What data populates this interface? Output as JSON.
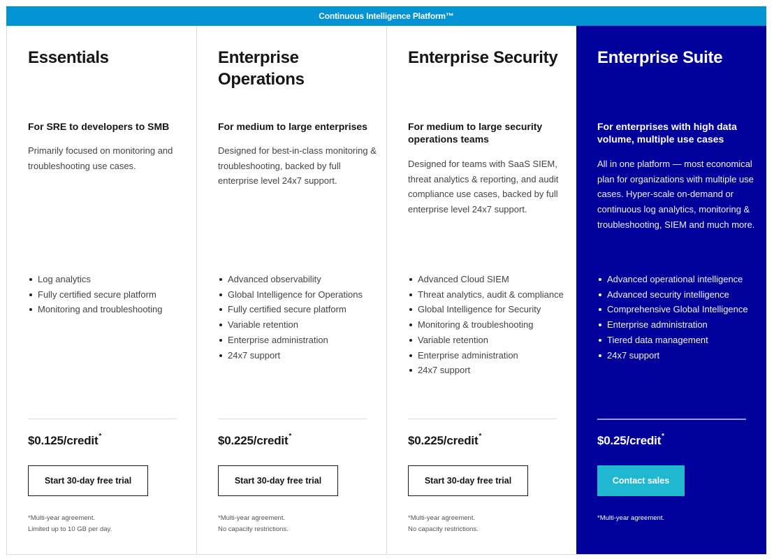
{
  "banner": {
    "title": "Continuous Intelligence Platform™"
  },
  "colors": {
    "banner": "#0193d3",
    "featured_bg": "#00009b",
    "cta_accent": "#20b8d0"
  },
  "plans": [
    {
      "title": "Essentials",
      "subtitle": "For SRE to developers to SMB",
      "description": "Primarily focused on monitoring and troubleshooting use cases.",
      "features": [
        "Log analytics",
        "Fully certified secure platform",
        "Monitoring and troubleshooting"
      ],
      "price": "$0.125/credit",
      "price_mark": "*",
      "cta": "Start 30-day free trial",
      "fine_print": [
        "*Multi-year agreement.",
        "Limited up to 10 GB per day."
      ]
    },
    {
      "title": "Enterprise Operations",
      "subtitle": "For medium to large enterprises",
      "description": "Designed for best-in-class monitoring & troubleshooting, backed by full enterprise level 24x7 support.",
      "features": [
        "Advanced observability",
        "Global Intelligence for Operations",
        "Fully certified secure platform",
        "Variable retention",
        "Enterprise administration",
        "24x7 support"
      ],
      "price": "$0.225/credit",
      "price_mark": "*",
      "cta": "Start 30-day free trial",
      "fine_print": [
        "*Multi-year agreement.",
        "No capacity restrictions."
      ]
    },
    {
      "title": "Enterprise Security",
      "subtitle": "For medium to large security operations teams",
      "description": "Designed for teams with SaaS SIEM, threat analytics & reporting, and audit compliance use cases, backed by full enterprise level 24x7 support.",
      "features": [
        "Advanced Cloud SIEM",
        "Threat analytics, audit & compliance",
        "Global Intelligence for Security",
        "Monitoring & troubleshooting",
        "Variable retention",
        "Enterprise administration",
        "24x7 support"
      ],
      "price": "$0.225/credit",
      "price_mark": "*",
      "cta": "Start 30-day free trial",
      "fine_print": [
        "*Multi-year agreement.",
        "No capacity restrictions."
      ]
    },
    {
      "title": "Enterprise Suite",
      "subtitle": "For enterprises with high data volume, multiple use cases",
      "description": "All in one platform — most economical plan for organizations with multiple use cases. Hyper-scale on-demand or continuous log analytics, monitoring & troubleshooting, SIEM and much more.",
      "features": [
        "Advanced operational intelligence",
        "Advanced security intelligence",
        "Comprehensive Global Intelligence",
        "Enterprise administration",
        "Tiered data management",
        "24x7 support"
      ],
      "price": "$0.25/credit",
      "price_mark": "*",
      "cta": "Contact sales",
      "fine_print": [
        "*Multi-year agreement."
      ]
    }
  ]
}
